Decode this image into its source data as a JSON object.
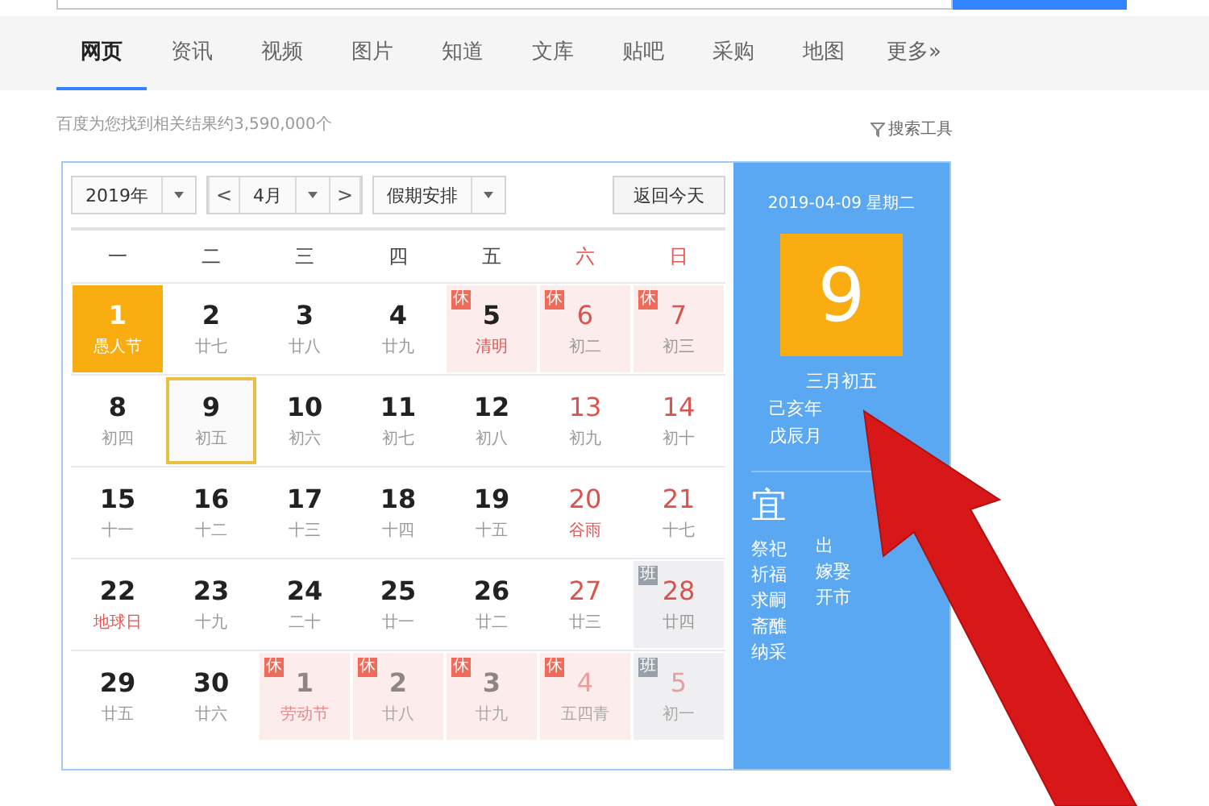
{
  "tabs": [
    {
      "label": "网页",
      "selected": true
    },
    {
      "label": "资讯",
      "selected": false
    },
    {
      "label": "视频",
      "selected": false
    },
    {
      "label": "图片",
      "selected": false
    },
    {
      "label": "知道",
      "selected": false
    },
    {
      "label": "文库",
      "selected": false
    },
    {
      "label": "贴吧",
      "selected": false
    },
    {
      "label": "采购",
      "selected": false
    },
    {
      "label": "地图",
      "selected": false
    },
    {
      "label": "更多»",
      "selected": false
    }
  ],
  "result_count": "百度为您找到相关结果约3,590,000个",
  "search_tools": "搜索工具",
  "calendar": {
    "year_select": "2019年",
    "prev": "<",
    "month_select": "4月",
    "next": ">",
    "holiday_select": "假期安排",
    "today_button": "返回今天",
    "weekdays": [
      {
        "label": "一",
        "weekend": false
      },
      {
        "label": "二",
        "weekend": false
      },
      {
        "label": "三",
        "weekend": false
      },
      {
        "label": "四",
        "weekend": false
      },
      {
        "label": "五",
        "weekend": false
      },
      {
        "label": "六",
        "weekend": true
      },
      {
        "label": "日",
        "weekend": true
      }
    ],
    "weeks": [
      [
        {
          "day": "1",
          "lunar": "愚人节",
          "kind": "today",
          "weekend": false,
          "festival": false,
          "other_month": false,
          "selected": false
        },
        {
          "day": "2",
          "lunar": "廿七",
          "kind": "normal",
          "weekend": false,
          "festival": false,
          "other_month": false,
          "selected": false
        },
        {
          "day": "3",
          "lunar": "廿八",
          "kind": "normal",
          "weekend": false,
          "festival": false,
          "other_month": false,
          "selected": false
        },
        {
          "day": "4",
          "lunar": "廿九",
          "kind": "normal",
          "weekend": false,
          "festival": false,
          "other_month": false,
          "selected": false
        },
        {
          "day": "5",
          "lunar": "清明",
          "kind": "rest",
          "badge": "休",
          "weekend": false,
          "festival": true,
          "other_month": false,
          "selected": false
        },
        {
          "day": "6",
          "lunar": "初二",
          "kind": "rest",
          "badge": "休",
          "weekend": true,
          "festival": false,
          "other_month": false,
          "selected": false
        },
        {
          "day": "7",
          "lunar": "初三",
          "kind": "rest",
          "badge": "休",
          "weekend": true,
          "festival": false,
          "other_month": false,
          "selected": false
        }
      ],
      [
        {
          "day": "8",
          "lunar": "初四",
          "kind": "normal",
          "weekend": false,
          "festival": false,
          "other_month": false,
          "selected": false
        },
        {
          "day": "9",
          "lunar": "初五",
          "kind": "normal",
          "weekend": false,
          "festival": false,
          "other_month": false,
          "selected": true
        },
        {
          "day": "10",
          "lunar": "初六",
          "kind": "normal",
          "weekend": false,
          "festival": false,
          "other_month": false,
          "selected": false
        },
        {
          "day": "11",
          "lunar": "初七",
          "kind": "normal",
          "weekend": false,
          "festival": false,
          "other_month": false,
          "selected": false
        },
        {
          "day": "12",
          "lunar": "初八",
          "kind": "normal",
          "weekend": false,
          "festival": false,
          "other_month": false,
          "selected": false
        },
        {
          "day": "13",
          "lunar": "初九",
          "kind": "normal",
          "weekend": true,
          "festival": false,
          "other_month": false,
          "selected": false
        },
        {
          "day": "14",
          "lunar": "初十",
          "kind": "normal",
          "weekend": true,
          "festival": false,
          "other_month": false,
          "selected": false
        }
      ],
      [
        {
          "day": "15",
          "lunar": "十一",
          "kind": "normal",
          "weekend": false,
          "festival": false,
          "other_month": false,
          "selected": false
        },
        {
          "day": "16",
          "lunar": "十二",
          "kind": "normal",
          "weekend": false,
          "festival": false,
          "other_month": false,
          "selected": false
        },
        {
          "day": "17",
          "lunar": "十三",
          "kind": "normal",
          "weekend": false,
          "festival": false,
          "other_month": false,
          "selected": false
        },
        {
          "day": "18",
          "lunar": "十四",
          "kind": "normal",
          "weekend": false,
          "festival": false,
          "other_month": false,
          "selected": false
        },
        {
          "day": "19",
          "lunar": "十五",
          "kind": "normal",
          "weekend": false,
          "festival": false,
          "other_month": false,
          "selected": false
        },
        {
          "day": "20",
          "lunar": "谷雨",
          "kind": "normal",
          "weekend": true,
          "festival": true,
          "other_month": false,
          "selected": false
        },
        {
          "day": "21",
          "lunar": "十七",
          "kind": "normal",
          "weekend": true,
          "festival": false,
          "other_month": false,
          "selected": false
        }
      ],
      [
        {
          "day": "22",
          "lunar": "地球日",
          "kind": "normal",
          "weekend": false,
          "festival": true,
          "other_month": false,
          "selected": false
        },
        {
          "day": "23",
          "lunar": "十九",
          "kind": "normal",
          "weekend": false,
          "festival": false,
          "other_month": false,
          "selected": false
        },
        {
          "day": "24",
          "lunar": "二十",
          "kind": "normal",
          "weekend": false,
          "festival": false,
          "other_month": false,
          "selected": false
        },
        {
          "day": "25",
          "lunar": "廿一",
          "kind": "normal",
          "weekend": false,
          "festival": false,
          "other_month": false,
          "selected": false
        },
        {
          "day": "26",
          "lunar": "廿二",
          "kind": "normal",
          "weekend": false,
          "festival": false,
          "other_month": false,
          "selected": false
        },
        {
          "day": "27",
          "lunar": "廿三",
          "kind": "normal",
          "weekend": true,
          "festival": false,
          "other_month": false,
          "selected": false
        },
        {
          "day": "28",
          "lunar": "廿四",
          "kind": "work",
          "badge": "班",
          "weekend": true,
          "festival": false,
          "other_month": false,
          "selected": false
        }
      ],
      [
        {
          "day": "29",
          "lunar": "廿五",
          "kind": "normal",
          "weekend": false,
          "festival": false,
          "other_month": false,
          "selected": false
        },
        {
          "day": "30",
          "lunar": "廿六",
          "kind": "normal",
          "weekend": false,
          "festival": false,
          "other_month": false,
          "selected": false
        },
        {
          "day": "1",
          "lunar": "劳动节",
          "kind": "rest",
          "badge": "休",
          "weekend": false,
          "festival": true,
          "other_month": true,
          "selected": false
        },
        {
          "day": "2",
          "lunar": "廿八",
          "kind": "rest",
          "badge": "休",
          "weekend": false,
          "festival": false,
          "other_month": true,
          "selected": false
        },
        {
          "day": "3",
          "lunar": "廿九",
          "kind": "rest",
          "badge": "休",
          "weekend": false,
          "festival": false,
          "other_month": true,
          "selected": false
        },
        {
          "day": "4",
          "lunar": "五四青",
          "kind": "rest",
          "badge": "休",
          "weekend": true,
          "festival": false,
          "other_month": true,
          "selected": false
        },
        {
          "day": "5",
          "lunar": "初一",
          "kind": "work",
          "badge": "班",
          "weekend": true,
          "festival": false,
          "other_month": true,
          "selected": false
        }
      ]
    ]
  },
  "detail": {
    "date": "2019-04-09 星期二",
    "day": "9",
    "lunar": "三月初五",
    "ganzhi": [
      "己亥年",
      "戊辰月"
    ],
    "yi_title": "宜",
    "yi_left": [
      "祭祀",
      "祈福",
      "求嗣",
      "斋醮",
      "纳采"
    ],
    "yi_right": [
      "出",
      "嫁娶",
      "开市"
    ]
  }
}
